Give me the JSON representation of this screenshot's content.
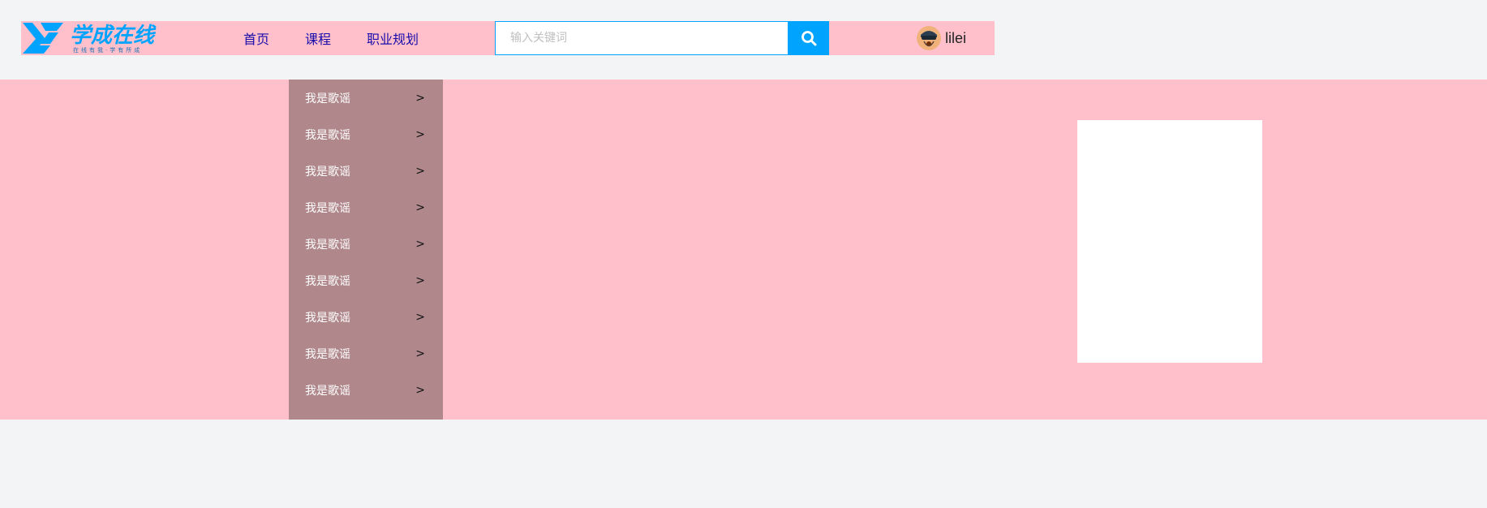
{
  "header": {
    "logo": {
      "title": "学成在线",
      "slogan": "在线有我·学有所成"
    },
    "nav": [
      {
        "label": "首页"
      },
      {
        "label": "课程"
      },
      {
        "label": "职业规划"
      }
    ],
    "search": {
      "placeholder": "输入关键词",
      "value": "",
      "button_icon": "search-icon"
    },
    "user": {
      "avatar_icon": "avatar",
      "name": "lilei"
    }
  },
  "banner": {
    "menu": [
      {
        "label": "我是歌谣",
        "arrow": ">"
      },
      {
        "label": "我是歌谣",
        "arrow": ">"
      },
      {
        "label": "我是歌谣",
        "arrow": ">"
      },
      {
        "label": "我是歌谣",
        "arrow": ">"
      },
      {
        "label": "我是歌谣",
        "arrow": ">"
      },
      {
        "label": "我是歌谣",
        "arrow": ">"
      },
      {
        "label": "我是歌谣",
        "arrow": ">"
      },
      {
        "label": "我是歌谣",
        "arrow": ">"
      },
      {
        "label": "我是歌谣",
        "arrow": ">"
      }
    ]
  },
  "colors": {
    "accent": "#00a4ff",
    "header_bg": "#ffc0cb",
    "menu_bg": "#b0888c",
    "nav_text": "#1a0dab",
    "page_bg": "#f3f4f6"
  }
}
